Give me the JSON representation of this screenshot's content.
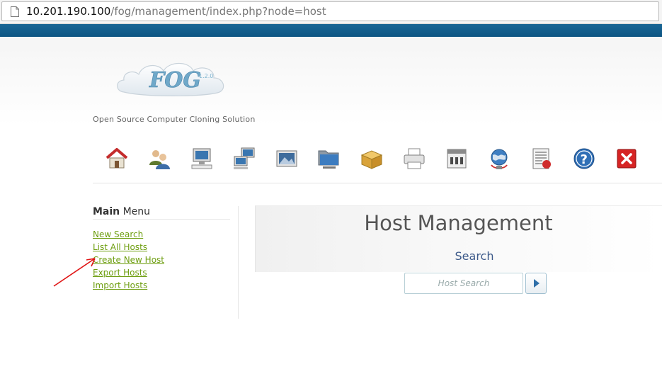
{
  "browser": {
    "url_host": "10.201.190.100",
    "url_path": "/fog/management/index.php?node=host"
  },
  "header": {
    "logo_text": "FOG",
    "logo_version": "1.2.0",
    "tagline": "Open Source Computer Cloning Solution"
  },
  "nav": {
    "icons": [
      "home-icon",
      "users-icon",
      "host-icon",
      "groups-icon",
      "images-icon",
      "storage-icon",
      "snapins-icon",
      "printer-icon",
      "service-icon",
      "tasks-icon",
      "reports-icon",
      "help-icon",
      "logout-icon"
    ]
  },
  "sidebar": {
    "title_bold": "Main",
    "title_rest": " Menu",
    "items": [
      {
        "label": "New Search"
      },
      {
        "label": "List All Hosts"
      },
      {
        "label": "Create New Host"
      },
      {
        "label": "Export Hosts"
      },
      {
        "label": "Import Hosts"
      }
    ]
  },
  "main": {
    "title": "Host Management",
    "section": "Search",
    "search_placeholder": "Host Search"
  },
  "colors": {
    "top_band": "#0c5482",
    "link": "#6e9e10",
    "section_title": "#3d5a8a",
    "annotation_arrow": "#e01414"
  }
}
